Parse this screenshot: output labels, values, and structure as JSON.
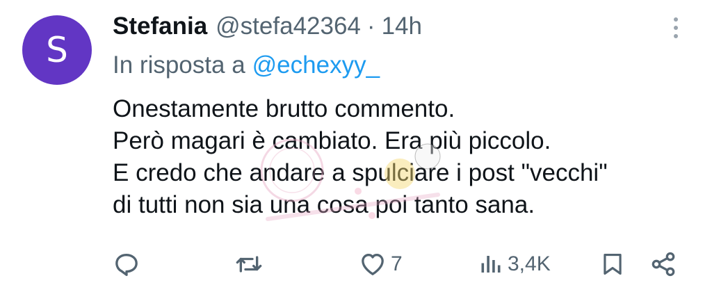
{
  "tweet": {
    "avatar_letter": "S",
    "display_name": "Stefania",
    "handle": "@stefa42364",
    "separator": "·",
    "time": "14h",
    "reply_prefix": "In risposta a",
    "reply_handle": "@echexyy_",
    "lines": [
      "Onestamente brutto commento.",
      "Però magari è cambiato. Era più piccolo.",
      "E credo che andare a spulciare i post \"vecchi\"",
      "di tutti non sia una cosa poi tanto sana."
    ],
    "likes": "7",
    "views": "3,4K"
  },
  "colors": {
    "avatar_bg": "#6236c4",
    "text": "#0f1419",
    "secondary": "#536471",
    "link": "#1d9bf0"
  },
  "icons": {
    "more": "more-vertical-icon",
    "reply": "reply-icon",
    "retweet": "retweet-icon",
    "like": "heart-icon",
    "views": "views-icon",
    "bookmark": "bookmark-icon",
    "share": "share-icon"
  }
}
